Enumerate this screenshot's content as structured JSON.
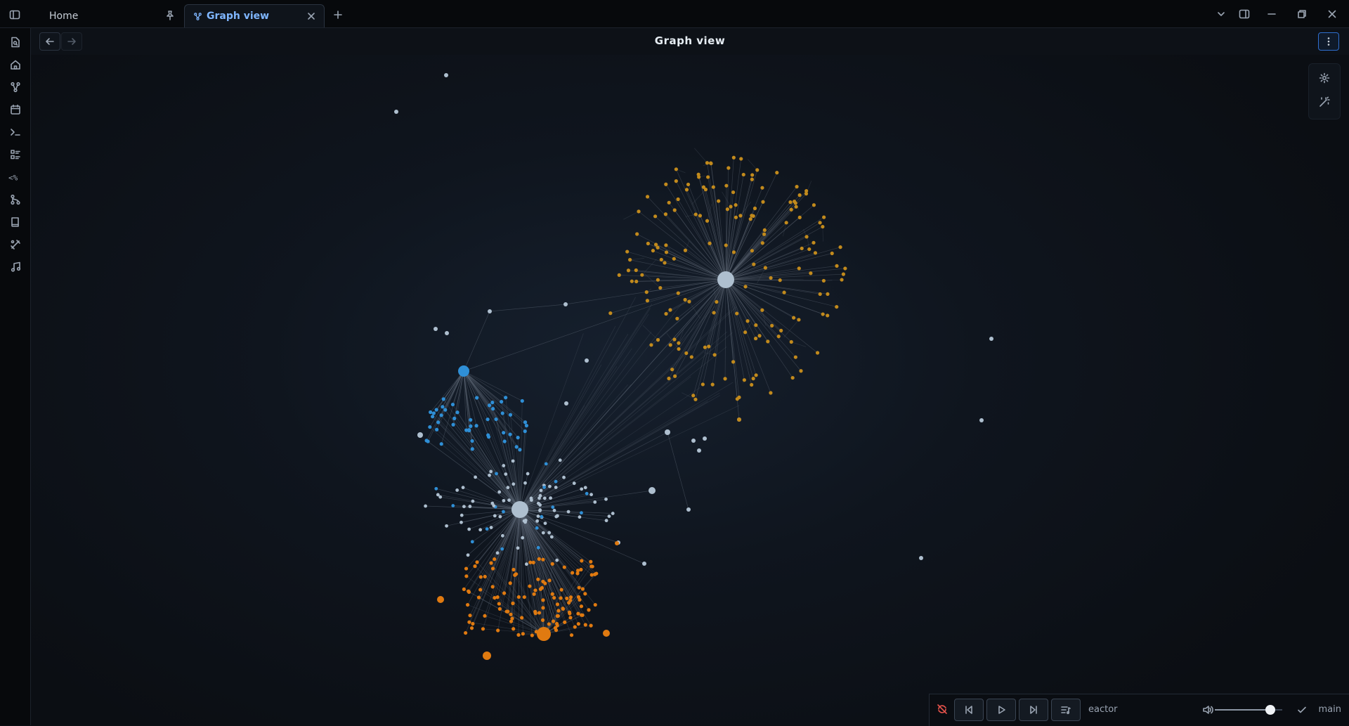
{
  "window": {
    "tabs": [
      {
        "label": "Home",
        "icon": "pin-icon"
      },
      {
        "label": "Graph view",
        "icon": "graph-icon"
      }
    ]
  },
  "view": {
    "title": "Graph view"
  },
  "ribbon": {
    "items": [
      "file-search-icon",
      "home-icon",
      "graph-icon",
      "calendar-icon",
      "terminal-icon",
      "checklist-icon",
      "template-icon",
      "git-icon",
      "book-icon",
      "tools-icon",
      "music-icon"
    ]
  },
  "graph_controls": [
    "gear-icon",
    "magic-wand-icon"
  ],
  "media": {
    "track": "eactor",
    "volume": 0.82,
    "branch": "main"
  },
  "colors": {
    "accent": "#7fb6ff",
    "node_default": "#aebfcf",
    "node_gold": "#c28a1c",
    "node_blue": "#2f8fd6",
    "node_orange": "#e07a10",
    "edge": "#5a6472"
  }
}
